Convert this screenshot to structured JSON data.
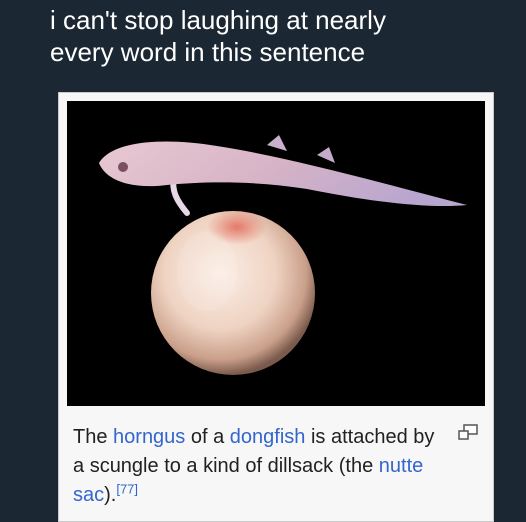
{
  "meme": {
    "caption_line1": "i can't stop laughing at nearly",
    "caption_line2": "every word in this sentence"
  },
  "wiki": {
    "w_the": "The",
    "horngus": "horngus",
    "w_of_a": "of a",
    "dongfish": "dongfish",
    "w_is": "is",
    "w_attached": "attached by a",
    "scungle": "scungle",
    "w_to_kind": "to a kind of",
    "dillsack": "dillsack",
    "w_the_paren": "(the",
    "nutte_sac": "nutte sac",
    "w_close": ").",
    "citation": "[77]",
    "enlarge_icon": "magnify-clip-icon"
  },
  "colors": {
    "background": "#1b2733",
    "link": "#3366cc",
    "text": "#202122"
  }
}
